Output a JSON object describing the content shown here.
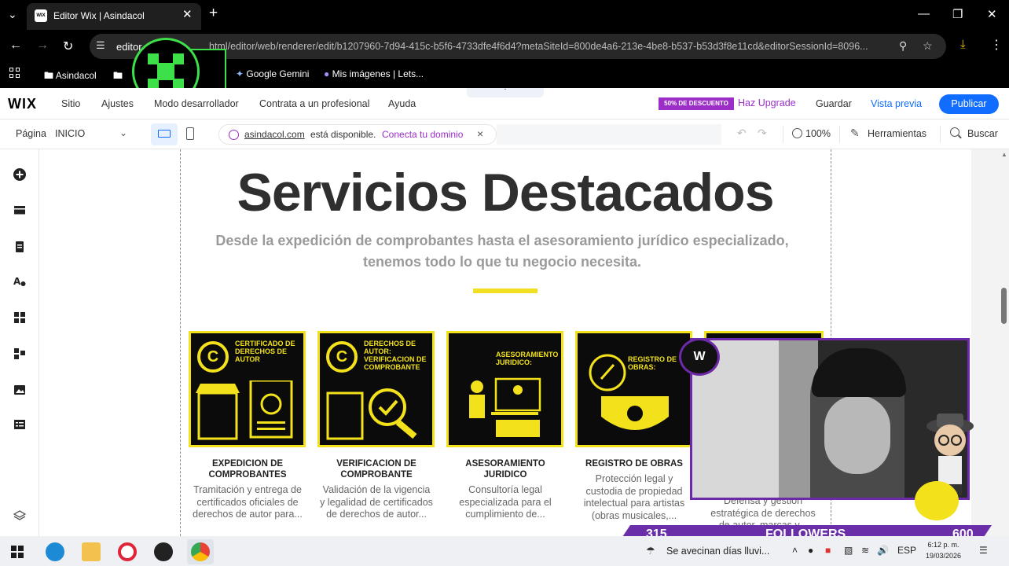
{
  "browser": {
    "tab_title": "Editor Wix | Asindacol",
    "tab_favicon": "WIX",
    "url_host": "editor",
    "url_path": "html/editor/web/renderer/edit/b1207960-7d94-415c-b5f6-4733dfe4f6d4?metaSiteId=800de4a6-213e-4be8-b537-b53d3f8e11cd&editorSessionId=8096...",
    "bookmarks": [
      "Asindacol",
      "Google Gemini",
      "Mis imágenes | Lets..."
    ]
  },
  "wix_top": {
    "logo": "WIX",
    "menu": [
      "Sitio",
      "Ajustes",
      "Modo desarrollador",
      "Contrata a un profesional",
      "Ayuda"
    ],
    "promo": "50% DE DESCUENTO",
    "upgrade": "Haz Upgrade",
    "save": "Guardar",
    "preview": "Vista previa",
    "publish": "Publicar"
  },
  "wix_sub": {
    "page_label": "Página",
    "page_value": "INICIO",
    "domain_name": "asindacol.com",
    "domain_available": "está disponible.",
    "domain_cta": "Conecta tu dominio",
    "zoom": "100%",
    "tools": "Herramientas",
    "search": "Buscar"
  },
  "content": {
    "heading": "Servicios Destacados",
    "subheading_line1": "Desde la expedición de comprobantes hasta el asesoramiento jurídico especializado,",
    "subheading_line2": "tenemos todo lo que tu negocio necesita.",
    "cards": [
      {
        "img_label": "CERTIFICADO DE DERECHOS DE AUTOR",
        "title_l1": "EXPEDICION DE",
        "title_l2": "COMPROBANTES",
        "desc_l1": "Tramitación y entrega de",
        "desc_l2": "certificados oficiales de",
        "desc_l3": "derechos de autor para..."
      },
      {
        "img_label": "DERECHOS DE AUTOR: VERIFICACION DE COMPROBANTE",
        "title_l1": "VERIFICACION DE",
        "title_l2": "COMPROBANTE",
        "desc_l1": "Validación de la vigencia",
        "desc_l2": "y legalidad de certificados",
        "desc_l3": "de derechos de autor..."
      },
      {
        "img_label": "ASESORAMIENTO JURIDICO:",
        "title_l1": "ASESORAMIENTO",
        "title_l2": "JURIDICO",
        "desc_l1": "Consultoría legal",
        "desc_l2": "especializada para el",
        "desc_l3": "cumplimiento de..."
      },
      {
        "img_label": "REGISTRO DE OBRAS:",
        "title_l1": "REGISTRO DE OBRAS",
        "title_l2": "",
        "desc_l1": "Protección legal y",
        "desc_l2": "custodia de propiedad",
        "desc_l3": "intelectual para artistas",
        "desc_l4": "(obras musicales,..."
      },
      {
        "desc_l1": "Defensa y gestión",
        "desc_l2": "estratégica de derechos",
        "desc_l3": "de autor, marcas y..."
      }
    ]
  },
  "stream_overlay": {
    "followers_left": "315",
    "followers_label": "FOLLOWERS",
    "followers_right": "600"
  },
  "taskbar": {
    "weather": "Se avecinan días lluvi...",
    "lang": "ESP",
    "time": "6:12 p. m.",
    "date": "19/03/2026"
  }
}
